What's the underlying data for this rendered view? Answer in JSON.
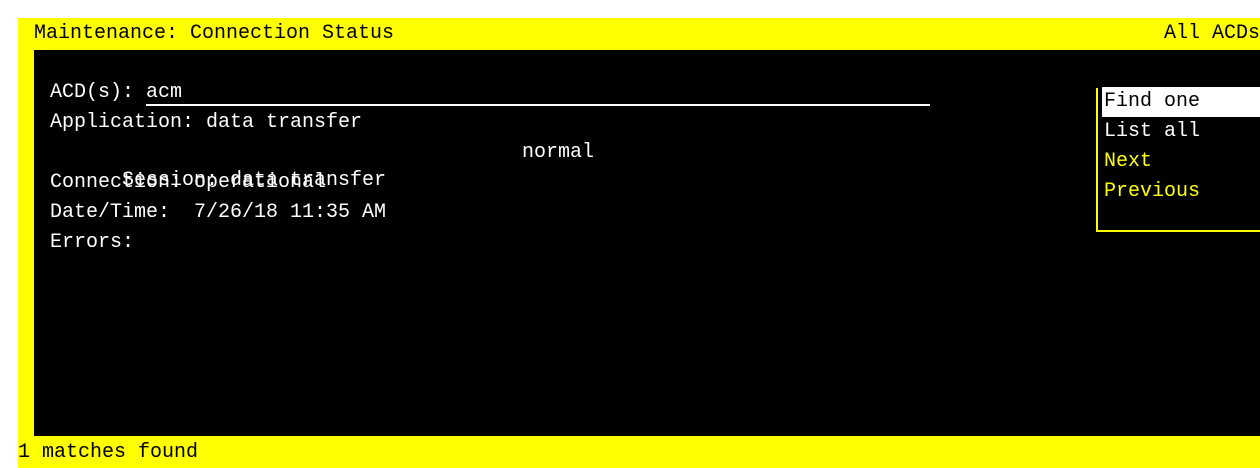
{
  "window": {
    "title": "Maintenance: Connection Status",
    "scope": "All ACDs"
  },
  "fields": {
    "acd_label": "ACD(s): ",
    "acd_value": "acm",
    "application": "Application: data transfer",
    "session": "Session: data transfer",
    "session_status": "normal",
    "connection": "Connection: operational",
    "datetime": "Date/Time:  7/26/18 11:35 AM",
    "errors": "Errors:"
  },
  "menu": {
    "items": [
      {
        "label": "Find one",
        "state": "selected"
      },
      {
        "label": "List all",
        "state": "normal"
      },
      {
        "label": "Next",
        "state": "highlighted"
      },
      {
        "label": "Previous",
        "state": "highlighted"
      }
    ]
  },
  "status": {
    "message": "1 matches found"
  },
  "colors": {
    "frame": "#ffff00",
    "background": "#000000",
    "text": "#ffffff",
    "highlight_text": "#ffff00"
  }
}
